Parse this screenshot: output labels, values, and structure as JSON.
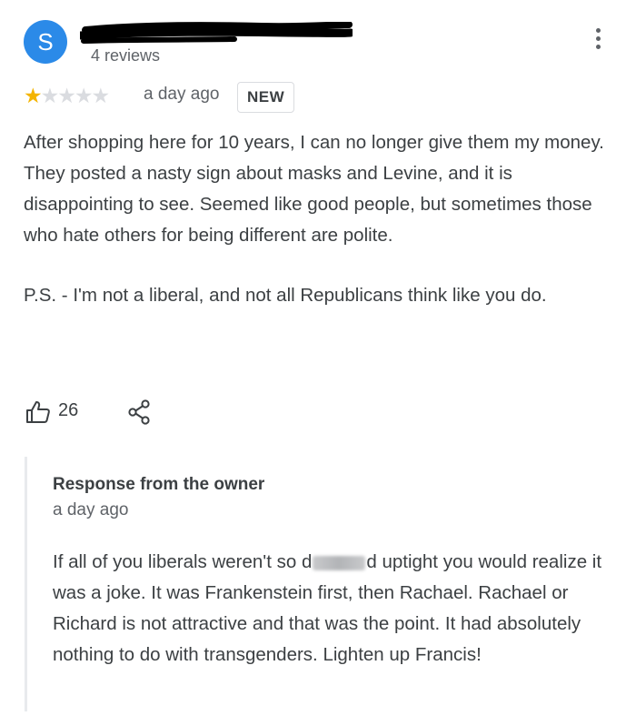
{
  "reviewer": {
    "avatar_letter": "S",
    "review_count": "4 reviews"
  },
  "review": {
    "rating": 1,
    "rating_max": 5,
    "stars_filled": "★",
    "stars_empty": "★★★★",
    "date": "a day ago",
    "badge": "NEW",
    "paragraph_1": "After shopping here for 10 years, I can no longer give them my money. They posted a nasty sign about masks and Levine, and it is disappointing to see. Seemed like good people, but sometimes those who hate others for being different are polite.",
    "paragraph_2": "P.S. - I'm not a liberal, and not all Republicans think like you do.",
    "like_count": "26"
  },
  "owner_response": {
    "title": "Response from the owner",
    "date": "a day ago",
    "text_before_blur": "If all of you liberals weren't so d",
    "text_after_blur": "d uptight you would realize it was a joke. It was Frankenstein first, then Rachael. Rachael or Richard is not attractive and that was the point. It had absolutely nothing to do with transgenders. Lighten up Francis!"
  },
  "icons": {
    "menu": "more-vert-icon",
    "like": "thumb-up-icon",
    "share": "share-icon"
  },
  "colors": {
    "avatar": "#2b8ae8",
    "star_filled": "#f4b400",
    "star_empty": "#dadce0",
    "secondary_text": "#5f6368",
    "body_text": "#3c4043",
    "redaction": "#000000"
  }
}
